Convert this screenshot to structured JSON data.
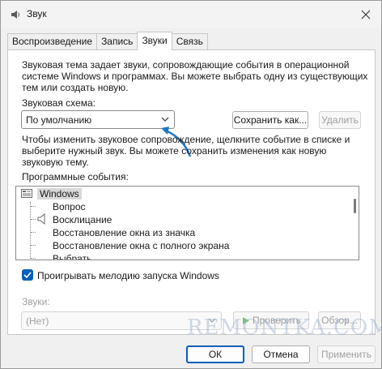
{
  "window": {
    "title": "Звук",
    "close_icon": "close-icon"
  },
  "tabs": [
    {
      "label": "Воспроизведение",
      "active": false
    },
    {
      "label": "Запись",
      "active": false
    },
    {
      "label": "Звуки",
      "active": true
    },
    {
      "label": "Связь",
      "active": false
    }
  ],
  "intro_text_1": "Звуковая тема задает звуки, сопровождающие события в операционной",
  "intro_text_2": "системе Windows и программах. Вы можете выбрать одну из существующих",
  "intro_text_3": "тем или создать новую.",
  "scheme": {
    "label": "Звуковая схема:",
    "value": "По умолчанию",
    "save_label": "Сохранить как...",
    "delete_label": "Удалить"
  },
  "change_text_1": "Чтобы изменить звуковое сопровождение, щелкните событие в списке и",
  "change_text_2": "выберите нужный звук. Вы можете сохранить изменения как новую",
  "change_text_3": "звуковую тему.",
  "events": {
    "label": "Программные события:",
    "root": "Windows",
    "items": [
      "Вопрос",
      "Восклицание",
      "Восстановление окна из значка",
      "Восстановление окна с полного экрана",
      "Выбрать"
    ]
  },
  "startup": {
    "label": "Проигрывать мелодию запуска Windows",
    "checked": true
  },
  "sounds": {
    "label": "Звуки:",
    "value": "(Нет)",
    "test_label": "Проверить",
    "browse_label": "Обзор..."
  },
  "footer": {
    "ok": "ОК",
    "cancel": "Отмена",
    "apply": "Применить"
  },
  "watermark": "REMONTKA.COM",
  "colors": {
    "accent": "#005fb8",
    "annotation": "#1e78c8"
  }
}
